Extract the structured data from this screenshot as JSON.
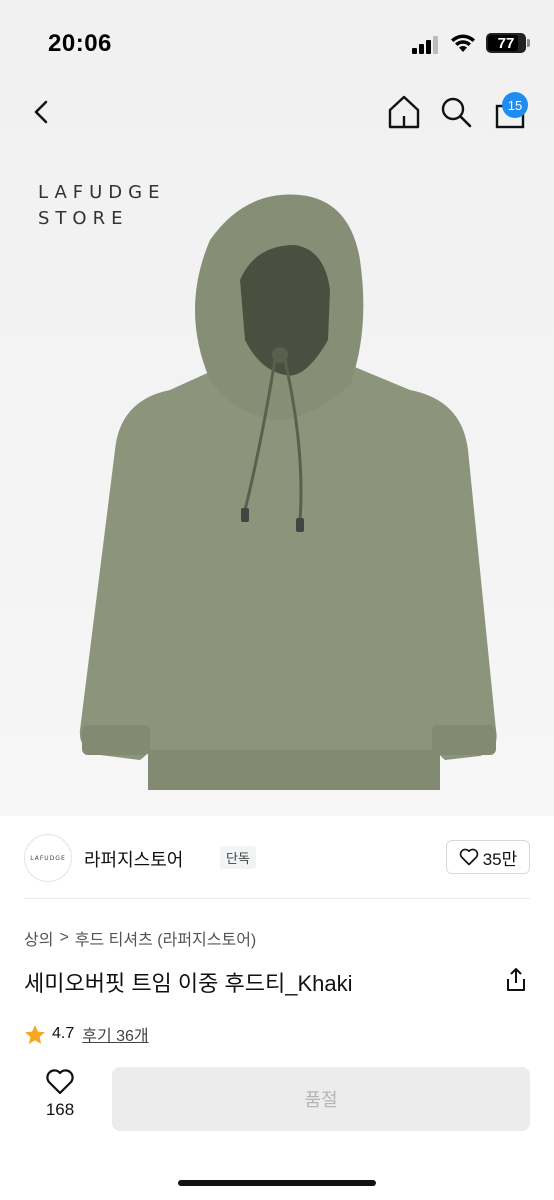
{
  "status_bar": {
    "time": "20:06",
    "battery": "77"
  },
  "nav": {
    "cart_count": "15"
  },
  "hero": {
    "brand_logo_line1": "LAFUDGE",
    "brand_logo_line2": "STORE",
    "product_color": "#8c947c"
  },
  "brand": {
    "avatar_text": "LAFUDGE",
    "name": "라퍼지스토어",
    "badge": "단독",
    "likes": "35만"
  },
  "breadcrumb": {
    "category": "상의",
    "separator": ">",
    "subcategory": "후드 티셔츠 (라퍼지스토어)"
  },
  "product": {
    "title": "세미오버핏 트임 이중 후드티_Khaki",
    "rating": "4.7",
    "reviews": "후기 36개"
  },
  "bottom": {
    "wish_count": "168",
    "buy_label": "품절"
  },
  "colors": {
    "accent": "#1f8cf0",
    "star": "#f5a623",
    "disabled_bg": "#ececec"
  }
}
